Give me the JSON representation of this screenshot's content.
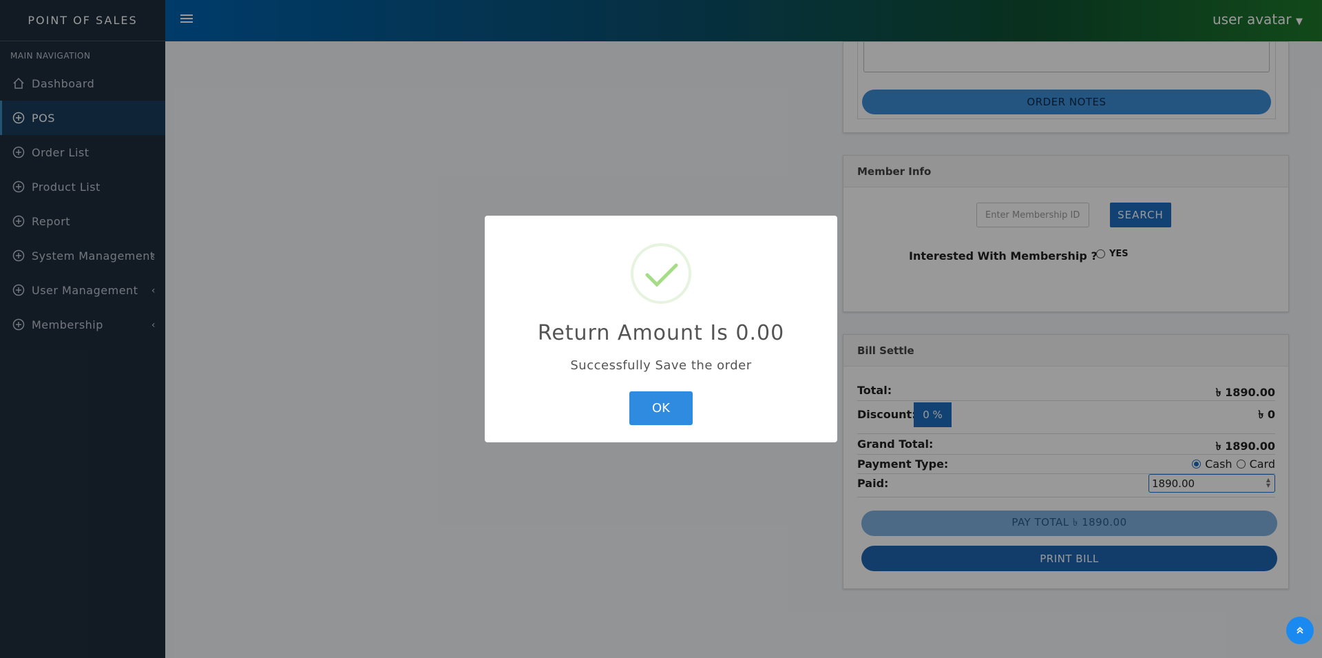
{
  "app": {
    "brand": "POINT OF SALES"
  },
  "sidebar": {
    "header": "MAIN NAVIGATION",
    "items": [
      {
        "label": "Dashboard",
        "icon": "home-icon",
        "active": false,
        "has_children": false
      },
      {
        "label": "POS",
        "icon": "plus-circle-icon",
        "active": true,
        "has_children": false
      },
      {
        "label": "Order List",
        "icon": "plus-circle-icon",
        "active": false,
        "has_children": false
      },
      {
        "label": "Product List",
        "icon": "plus-circle-icon",
        "active": false,
        "has_children": false
      },
      {
        "label": "Report",
        "icon": "plus-circle-icon",
        "active": false,
        "has_children": false
      },
      {
        "label": "System Management",
        "icon": "plus-circle-icon",
        "active": false,
        "has_children": true
      },
      {
        "label": "User Management",
        "icon": "plus-circle-icon",
        "active": false,
        "has_children": true
      },
      {
        "label": "Membership",
        "icon": "plus-circle-icon",
        "active": false,
        "has_children": true
      }
    ]
  },
  "header": {
    "user": "user avatar",
    "dropdown_icon": "caret-down-icon"
  },
  "order_notes": {
    "button_label": "ORDER NOTES"
  },
  "member_info": {
    "title": "Member Info",
    "input_placeholder": "Enter Membership ID",
    "search_label": "SEARCH",
    "interest_label": "Interested With Membership ?",
    "yes_label": "YES"
  },
  "bill_settle": {
    "title": "Bill Settle",
    "total_label": "Total:",
    "total_value": "৳ 1890.00",
    "discount_label": "Discount:",
    "discount_input": "0 %",
    "discount_value": "৳ 0",
    "grand_total_label": "Grand Total:",
    "grand_total_value": "৳ 1890.00",
    "payment_type_label": "Payment Type:",
    "cash_label": "Cash",
    "card_label": "Card",
    "selected_payment": "Cash",
    "paid_label": "Paid:",
    "paid_value": "1890.00",
    "pay_total_label": "PAY TOTAL ৳ 1890.00",
    "print_label": "PRINT BILL"
  },
  "modal": {
    "icon": "success-check-icon",
    "title": "Return Amount Is 0.00",
    "message": "Successfully Save the order",
    "ok_label": "OK"
  },
  "colors": {
    "sidebar_bg": "#1f2d3d",
    "header_gradient_start": "#0063b1",
    "header_gradient_end": "#1e7a2b",
    "primary": "#1f6fc0",
    "modal_button": "#2f8be0",
    "success": "#a5dc86"
  }
}
